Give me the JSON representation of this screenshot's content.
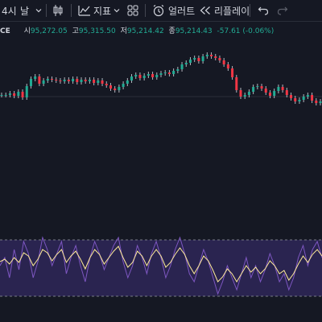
{
  "toolbar": {
    "interval": "4시",
    "interval2": "날",
    "indicators": "지표",
    "alert": "얼러트",
    "replay": "리플레이"
  },
  "legend": {
    "symbol_fragment": "CE",
    "open_label": "시",
    "open": "95,272.05",
    "high_label": "고",
    "high": "95,315.50",
    "low_label": "저",
    "low": "95,214.42",
    "close_label": "종",
    "close": "95,214.43",
    "change": "-57.61 (-0.06%)"
  },
  "colors": {
    "background": "#151823",
    "up": "#22ab94",
    "down": "#f23645",
    "price_wick": "#b2b5be",
    "oscillator_line": "#7e57c2",
    "oscillator_signal": "#ffeb99",
    "band_fill": "#2a2450",
    "band_border": "#787b86"
  },
  "chart_data": {
    "type": "candlestick",
    "price_y": [
      118,
      118,
      116,
      119,
      114,
      121,
      107,
      98,
      95,
      104,
      100,
      98,
      99,
      100,
      101,
      99,
      101,
      98,
      102,
      99,
      101,
      99,
      103,
      100,
      104,
      106,
      110,
      112,
      108,
      104,
      100,
      95,
      93,
      97,
      94,
      92,
      96,
      93,
      91,
      90,
      92,
      88,
      86,
      80,
      78,
      74,
      72,
      76,
      70,
      68,
      70,
      72,
      75,
      80,
      85,
      96,
      112,
      120,
      118,
      114,
      108,
      107,
      110,
      115,
      119,
      113,
      108,
      112,
      118,
      122,
      126,
      124,
      120,
      118,
      125,
      128,
      126
    ],
    "oscillator_y": [
      330,
      320,
      345,
      310,
      335,
      300,
      315,
      345,
      325,
      295,
      310,
      330,
      315,
      300,
      340,
      320,
      305,
      330,
      350,
      320,
      300,
      315,
      335,
      320,
      305,
      295,
      325,
      345,
      330,
      305,
      320,
      340,
      315,
      300,
      320,
      345,
      330,
      310,
      295,
      315,
      340,
      350,
      330,
      310,
      325,
      345,
      365,
      350,
      330,
      345,
      360,
      340,
      320,
      345,
      330,
      350,
      335,
      315,
      330,
      350,
      340,
      360,
      345,
      320,
      305,
      330,
      310,
      300,
      320
    ],
    "signal_y": [
      325,
      322,
      328,
      320,
      326,
      314,
      318,
      330,
      322,
      310,
      314,
      324,
      316,
      310,
      326,
      318,
      312,
      322,
      334,
      320,
      310,
      316,
      328,
      320,
      312,
      306,
      320,
      332,
      326,
      312,
      318,
      330,
      318,
      310,
      318,
      332,
      326,
      316,
      308,
      316,
      330,
      340,
      330,
      318,
      324,
      336,
      350,
      344,
      334,
      340,
      350,
      340,
      330,
      338,
      332,
      340,
      334,
      324,
      330,
      340,
      336,
      348,
      340,
      328,
      318,
      326,
      316,
      310,
      318
    ]
  }
}
